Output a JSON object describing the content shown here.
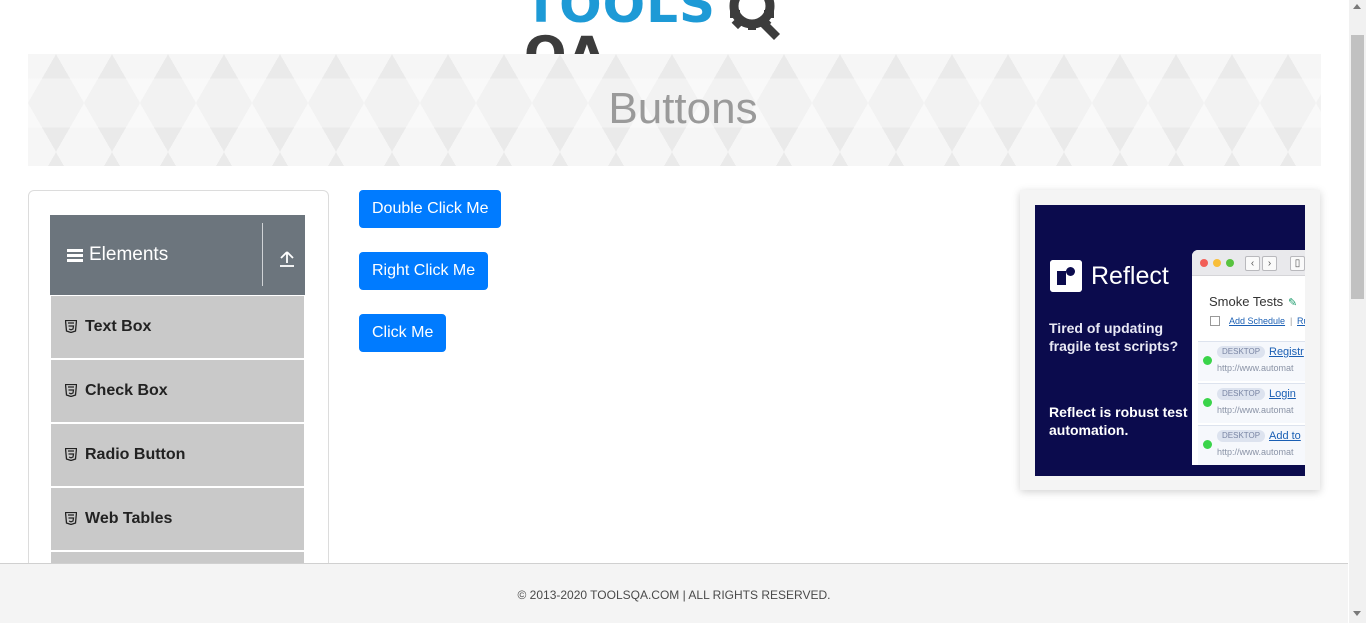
{
  "logo": {
    "text_left": "TOOLS",
    "text_right": "QA",
    "icon": "gear-icon"
  },
  "banner": {
    "title": "Buttons"
  },
  "sidebar": {
    "group": {
      "title": "Elements",
      "icon": "hamburger-icon",
      "toggle_icon": "collapse-up-icon"
    },
    "items": [
      {
        "label": "Text Box",
        "icon": "html5-icon"
      },
      {
        "label": "Check Box",
        "icon": "html5-icon"
      },
      {
        "label": "Radio Button",
        "icon": "html5-icon"
      },
      {
        "label": "Web Tables",
        "icon": "html5-icon"
      },
      {
        "label": "",
        "icon": ""
      }
    ]
  },
  "main": {
    "buttons": [
      {
        "label": "Double Click Me"
      },
      {
        "label": "Right Click Me"
      },
      {
        "label": "Click Me"
      }
    ]
  },
  "ad": {
    "brand": "Reflect",
    "pitch": "Tired of updating fragile test scripts?",
    "claim": "Reflect is robust test automation.",
    "mock": {
      "title": "Smoke Tests",
      "schedule_link": "Add Schedule",
      "separator": "|",
      "run_link": "Ru",
      "rows": [
        {
          "tag": "DESKTOP",
          "name": "Registr",
          "url": "http://www.automat"
        },
        {
          "tag": "DESKTOP",
          "name": "Login",
          "url": "http://www.automat"
        },
        {
          "tag": "DESKTOP",
          "name": "Add to",
          "url": "http://www.automat"
        }
      ]
    }
  },
  "footer": {
    "text": "© 2013-2020 TOOLSQA.COM | ALL RIGHTS RESERVED."
  },
  "colors": {
    "primary": "#007bff",
    "group_header": "#6c757d",
    "menu_item": "#c9c9c9",
    "ad_bg": "#0b0b4d"
  }
}
